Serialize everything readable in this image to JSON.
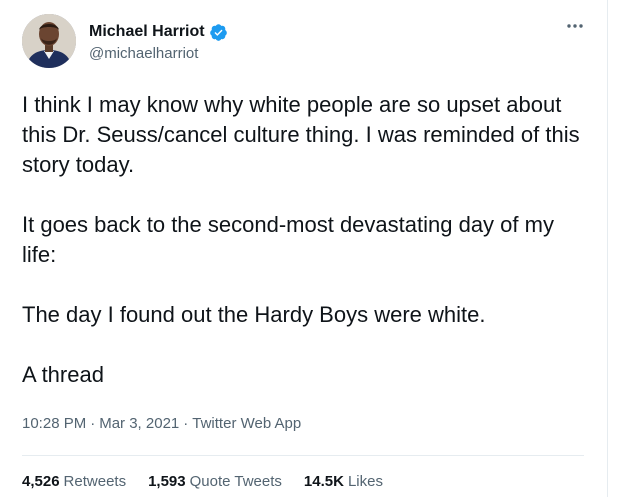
{
  "author": {
    "display_name": "Michael Harriot",
    "handle": "@michaelharriot",
    "verified": true
  },
  "tweet": {
    "paragraphs": [
      "I think I may know why white people are so upset about this Dr. Seuss/cancel culture thing. I was reminded of this story today.",
      "It goes back to the second-most devastating day of my life:",
      "The day I found out the Hardy Boys were white.",
      "A thread"
    ],
    "time": "10:28 PM",
    "date": "Mar 3, 2021",
    "separator": "·",
    "source": "Twitter Web App"
  },
  "stats": {
    "retweets": {
      "count": "4,526",
      "label": "Retweets"
    },
    "quote_tweets": {
      "count": "1,593",
      "label": "Quote Tweets"
    },
    "likes": {
      "count": "14.5K",
      "label": "Likes"
    }
  },
  "colors": {
    "text_primary": "#0f1419",
    "text_secondary": "#536471",
    "verified_blue": "#1d9bf0",
    "divider": "#e6ecf0"
  },
  "icons": {
    "verified": "verified-badge-icon",
    "more": "more-dots-icon"
  }
}
